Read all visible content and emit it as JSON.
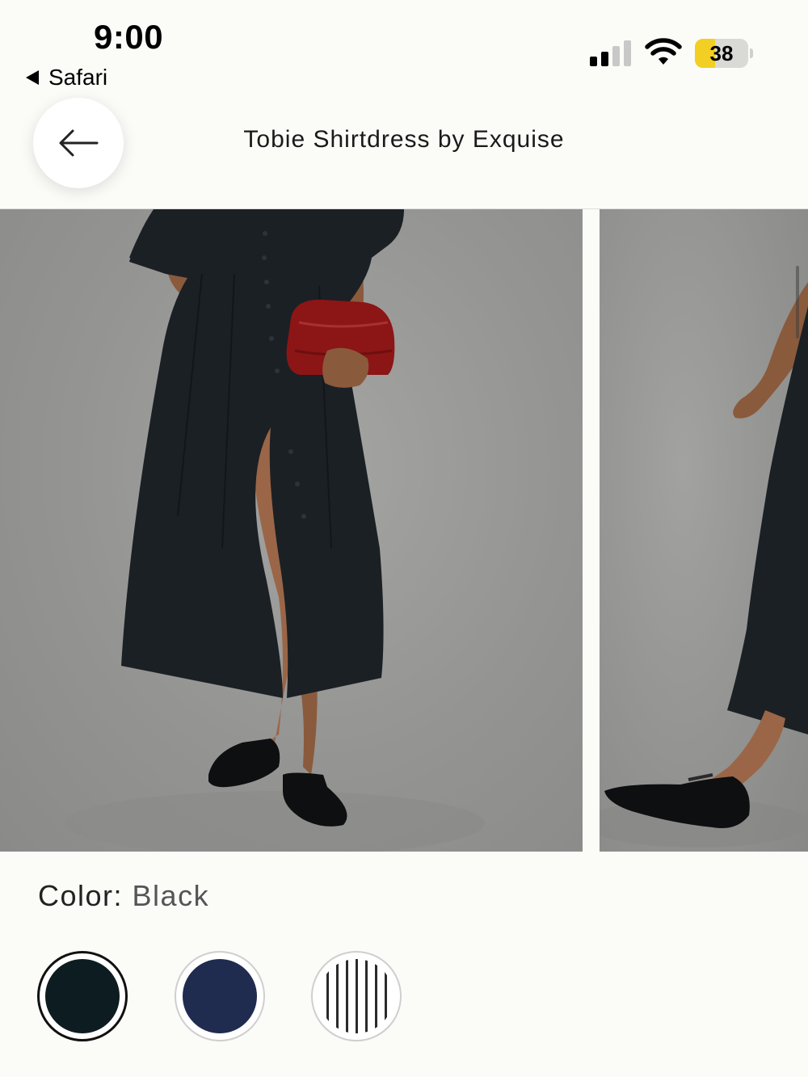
{
  "status_bar": {
    "time": "9:00",
    "back_app_label": "Safari",
    "battery_level": "38",
    "battery_percent": 38
  },
  "header": {
    "title": "Tobie Shirtdress by Exquise"
  },
  "carousel": {
    "slide_count_visible": 2
  },
  "color": {
    "label": "Color:",
    "value": "Black",
    "swatches": [
      {
        "name": "Black",
        "color": "#0d1c20",
        "selected": true
      },
      {
        "name": "Navy",
        "color": "#1f2b4f",
        "selected": false
      },
      {
        "name": "Stripe",
        "color": "#ffffff",
        "selected": false
      }
    ]
  },
  "colors": {
    "background": "#fbfbf8",
    "battery_fill": "#f2cf22"
  }
}
